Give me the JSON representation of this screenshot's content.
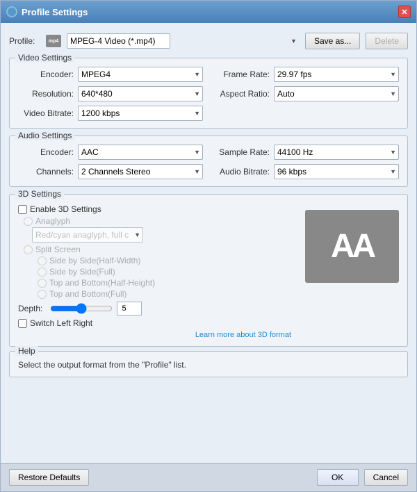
{
  "window": {
    "title": "Profile Settings",
    "close_label": "✕"
  },
  "profile": {
    "label": "Profile:",
    "value": "MPEG-4 Video (*.mp4)",
    "save_as_label": "Save as...",
    "delete_label": "Delete"
  },
  "video_settings": {
    "title": "Video Settings",
    "encoder_label": "Encoder:",
    "encoder_value": "MPEG4",
    "resolution_label": "Resolution:",
    "resolution_value": "640*480",
    "video_bitrate_label": "Video Bitrate:",
    "video_bitrate_value": "1200 kbps",
    "frame_rate_label": "Frame Rate:",
    "frame_rate_value": "29.97 fps",
    "aspect_ratio_label": "Aspect Ratio:",
    "aspect_ratio_value": "Auto"
  },
  "audio_settings": {
    "title": "Audio Settings",
    "encoder_label": "Encoder:",
    "encoder_value": "AAC",
    "channels_label": "Channels:",
    "channels_value": "2 Channels Stereo",
    "sample_rate_label": "Sample Rate:",
    "sample_rate_value": "44100 Hz",
    "audio_bitrate_label": "Audio Bitrate:",
    "audio_bitrate_value": "96 kbps"
  },
  "settings_3d": {
    "title": "3D Settings",
    "enable_label": "Enable 3D Settings",
    "anaglyph_label": "Anaglyph",
    "anaglyph_value": "Red/cyan anaglyph, full color",
    "split_screen_label": "Split Screen",
    "split_options": [
      "Side by Side(Half-Width)",
      "Side by Side(Full)",
      "Top and Bottom(Half-Height)",
      "Top and Bottom(Full)"
    ],
    "depth_label": "Depth:",
    "depth_value": "5",
    "switch_label": "Switch Left Right",
    "learn_link": "Learn more about 3D format",
    "preview_text": "AA"
  },
  "help": {
    "title": "Help",
    "text": "Select the output format from the \"Profile\" list."
  },
  "bottom": {
    "restore_label": "Restore Defaults",
    "ok_label": "OK",
    "cancel_label": "Cancel"
  }
}
